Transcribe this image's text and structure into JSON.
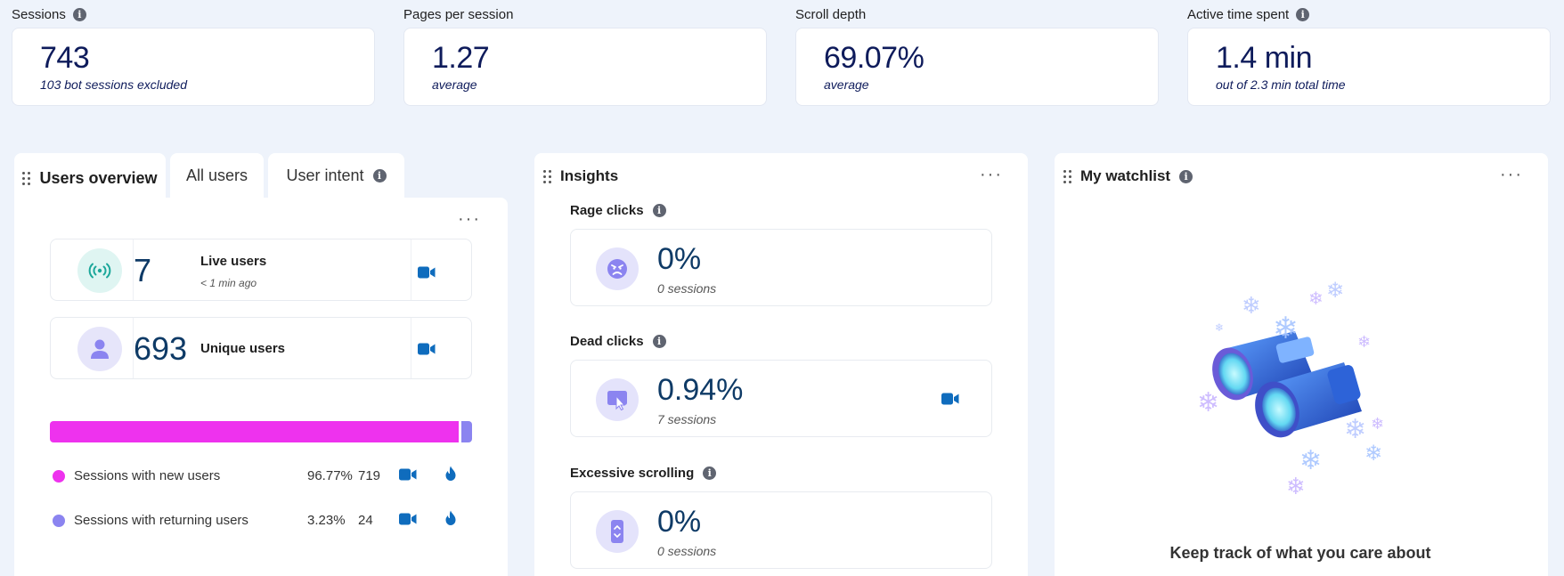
{
  "metrics": [
    {
      "label": "Sessions",
      "value": "743",
      "sub": "103 bot sessions excluded",
      "info": true
    },
    {
      "label": "Pages per session",
      "value": "1.27",
      "sub": "average",
      "info": false
    },
    {
      "label": "Scroll depth",
      "value": "69.07%",
      "sub": "average",
      "info": false
    },
    {
      "label": "Active time spent",
      "value": "1.4 min",
      "sub": "out of 2.3 min total time",
      "info": true
    }
  ],
  "users_panel": {
    "tabs": [
      "Users overview",
      "All users",
      "User intent"
    ],
    "live": {
      "count": "7",
      "label": "Live users",
      "time": "< 1 min ago"
    },
    "unique": {
      "count": "693",
      "label": "Unique users"
    },
    "bar": {
      "new_fraction": 0.9677,
      "colors": {
        "new": "#ee32ee",
        "returning": "#8b84f0"
      }
    },
    "legend": [
      {
        "label": "Sessions with new users",
        "pct": "96.77%",
        "count": "719"
      },
      {
        "label": "Sessions with returning users",
        "pct": "3.23%",
        "count": "24"
      }
    ]
  },
  "insights_panel": {
    "title": "Insights",
    "items": [
      {
        "label": "Rage clicks",
        "value": "0%",
        "sub": "0 sessions",
        "icon": "angry-face-icon"
      },
      {
        "label": "Dead clicks",
        "value": "0.94%",
        "sub": "7 sessions",
        "icon": "dead-click-icon"
      },
      {
        "label": "Excessive scrolling",
        "value": "0%",
        "sub": "0 sessions",
        "icon": "scroll-icon"
      }
    ]
  },
  "watchlist_panel": {
    "title": "My watchlist",
    "caption": "Keep track of what you care about"
  },
  "colors": {
    "accent_blue": "#0f6cbd",
    "metric_text": "#0e1b5b",
    "background": "#eef3fb"
  }
}
